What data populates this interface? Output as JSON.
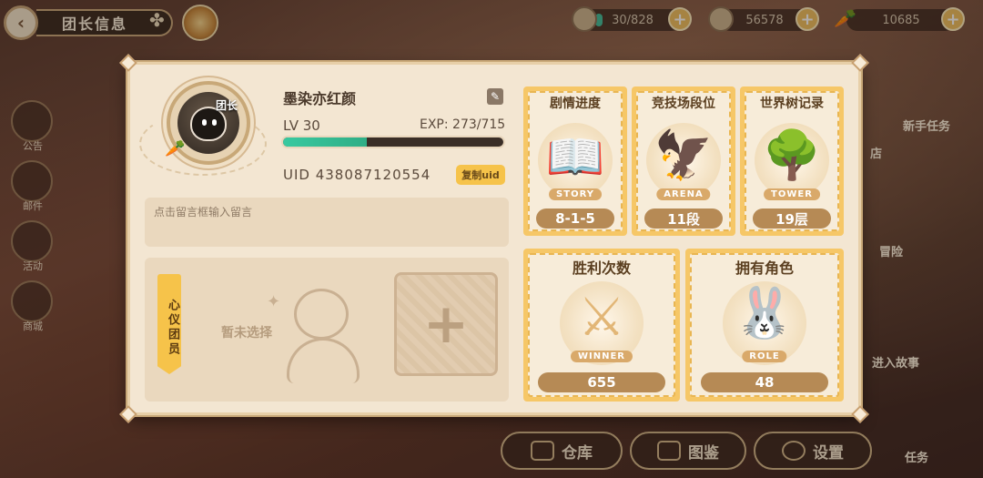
{
  "header": {
    "title": "团长信息",
    "back_icon": "back-arrow-icon",
    "clover_icon": "clover-icon"
  },
  "resources": {
    "stamina": {
      "text": "30/828",
      "icon": "stamina-icon",
      "level": 0.04
    },
    "gold": {
      "text": "56578",
      "icon": "gold-coin-icon"
    },
    "carrot": {
      "text": "10685",
      "icon": "carrot-icon"
    }
  },
  "sidebar": {
    "items": [
      {
        "label": "公告"
      },
      {
        "label": "邮件"
      },
      {
        "label": "活动"
      },
      {
        "label": "商城"
      }
    ]
  },
  "right_nav": {
    "newbie_task": "新手任务",
    "store": "店",
    "adventure": "冒险",
    "story": "进入故事",
    "task": "任务"
  },
  "bottom_nav": {
    "warehouse": "仓库",
    "gallery": "图鉴",
    "settings": "设置"
  },
  "profile": {
    "name": "墨染亦红颜",
    "leader_tag": "团长",
    "level": "LV 30",
    "exp_text": "EXP: 273/715",
    "exp_progress": 0.38,
    "uid": "UID 438087120554",
    "copy_label": "复制uid",
    "message_placeholder": "点击留言框输入留言"
  },
  "favorite_member": {
    "label": "心仪团员",
    "empty_text": "暂未选择",
    "add_symbol": "+"
  },
  "stats": {
    "story": {
      "title": "剧情进度",
      "tag": "STORY",
      "value": "8-1-5"
    },
    "arena": {
      "title": "竞技场段位",
      "tag": "ARENA",
      "value": "11段"
    },
    "tower": {
      "title": "世界树记录",
      "tag": "TOWER",
      "value": "19层"
    },
    "wins": {
      "title": "胜利次数",
      "tag": "WINNER",
      "value": "655"
    },
    "roles": {
      "title": "拥有角色",
      "tag": "ROLE",
      "value": "48"
    }
  },
  "colors": {
    "accent_gold": "#f6c767",
    "exp_green": "#39c9a0",
    "panel_bg": "#f3e6d2"
  }
}
